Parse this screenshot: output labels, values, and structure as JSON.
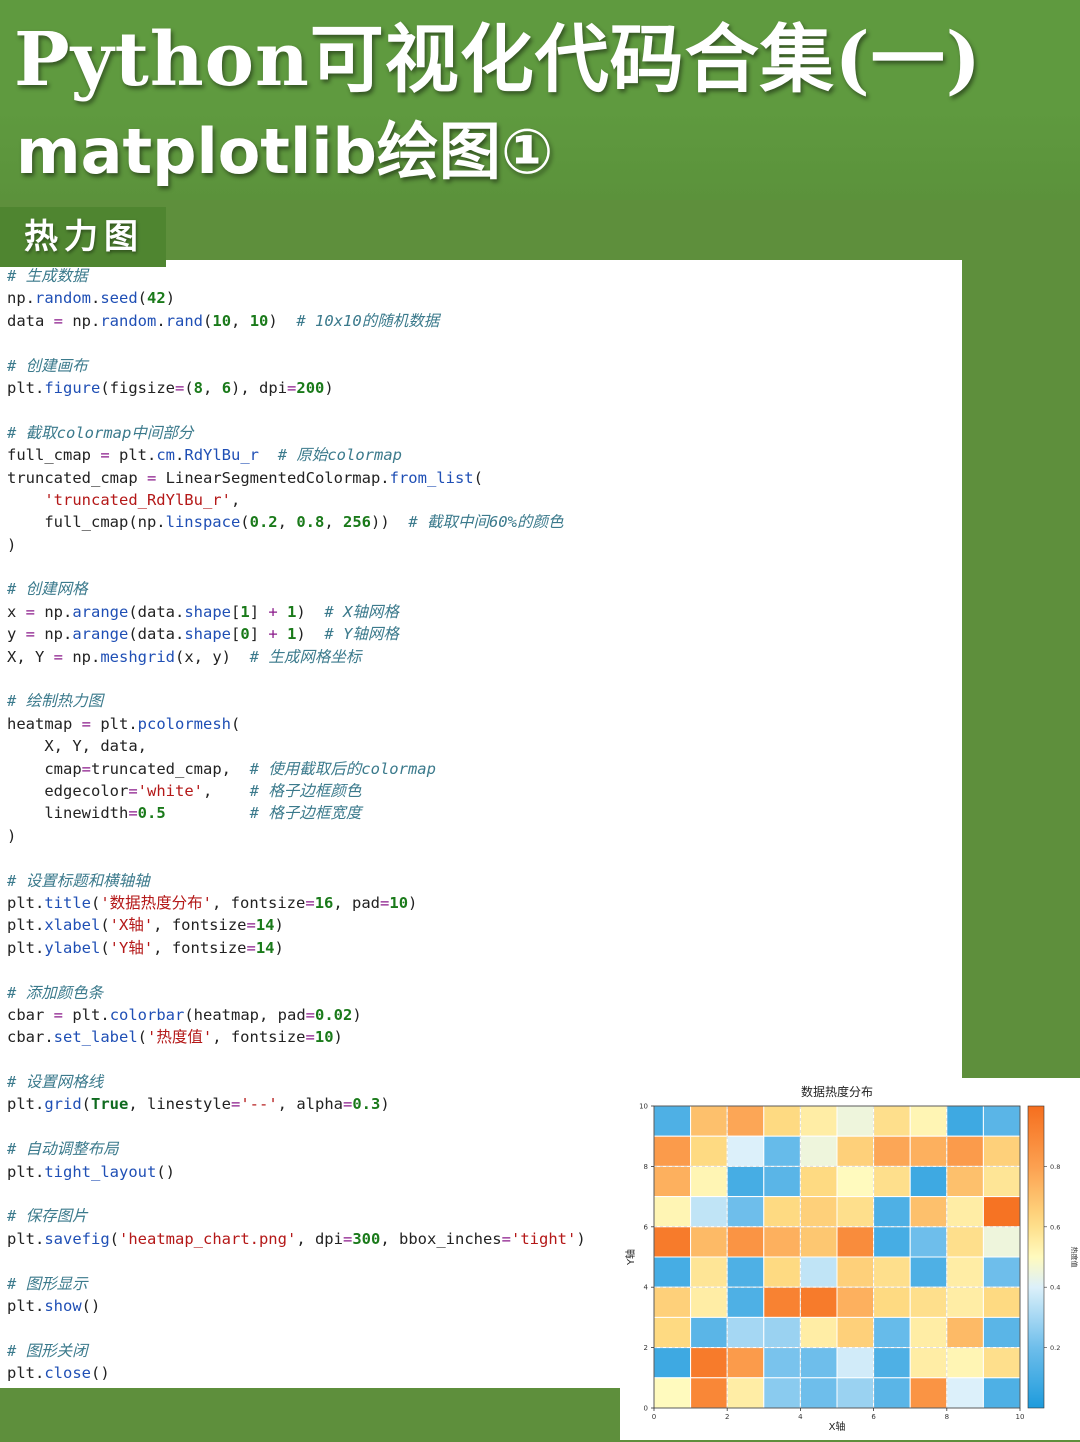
{
  "header": {
    "title_line1": "Python可视化代码合集(一)",
    "title_line2": "matplotlib绘图①",
    "section_label": "热力图"
  },
  "code_lines": [
    "# 生成数据",
    "np.random.seed(42)",
    "data = np.random.rand(10, 10)  # 10x10的随机数据",
    "",
    "# 创建画布",
    "plt.figure(figsize=(8, 6), dpi=200)",
    "",
    "# 截取colormap中间部分",
    "full_cmap = plt.cm.RdYlBu_r  # 原始colormap",
    "truncated_cmap = LinearSegmentedColormap.from_list(",
    "    'truncated_RdYlBu_r',",
    "    full_cmap(np.linspace(0.2, 0.8, 256))  # 截取中间60%的颜色",
    ")",
    "",
    "# 创建网格",
    "x = np.arange(data.shape[1] + 1)  # X轴网格",
    "y = np.arange(data.shape[0] + 1)  # Y轴网格",
    "X, Y = np.meshgrid(x, y)  # 生成网格坐标",
    "",
    "# 绘制热力图",
    "heatmap = plt.pcolormesh(",
    "    X, Y, data,",
    "    cmap=truncated_cmap,  # 使用截取后的colormap",
    "    edgecolor='white',    # 格子边框颜色",
    "    linewidth=0.5         # 格子边框宽度",
    ")",
    "",
    "# 设置标题和横轴轴",
    "plt.title('数据热度分布', fontsize=16, pad=10)",
    "plt.xlabel('X轴', fontsize=14)",
    "plt.ylabel('Y轴', fontsize=14)",
    "",
    "# 添加颜色条",
    "cbar = plt.colorbar(heatmap, pad=0.02)",
    "cbar.set_label('热度值', fontsize=10)",
    "",
    "# 设置网格线",
    "plt.grid(True, linestyle='--', alpha=0.3)",
    "",
    "# 自动调整布局",
    "plt.tight_layout()",
    "",
    "# 保存图片",
    "plt.savefig('heatmap_chart.png', dpi=300, bbox_inches='tight')",
    "",
    "# 图形显示",
    "plt.show()",
    "",
    "# 图形关闭",
    "plt.close()"
  ],
  "colors": {
    "background_green": "#5e8f3c",
    "comment": "#3b7a8c",
    "function": "#1f4fb5",
    "number": "#1a7a1a",
    "string": "#b41818"
  },
  "chart_data": {
    "type": "heatmap",
    "title": "数据热度分布",
    "xlabel": "X轴",
    "ylabel": "Y轴",
    "colorbar_label": "热度值",
    "xlim": [
      0,
      10
    ],
    "ylim": [
      0,
      10
    ],
    "x_ticks": [
      "0",
      "2",
      "4",
      "6",
      "8",
      "10"
    ],
    "y_ticks": [
      "0",
      "2",
      "4",
      "6",
      "8",
      "10"
    ],
    "colorbar_ticks": [
      "0.2",
      "0.4",
      "0.6",
      "0.8"
    ],
    "colorbar_range": [
      0.0,
      1.0
    ],
    "grid": true,
    "colormap": "truncated RdYlBu_r (0.2-0.8)",
    "values_top_row_first": [
      [
        0.12,
        0.7,
        0.78,
        0.62,
        0.55,
        0.45,
        0.6,
        0.52,
        0.08,
        0.15
      ],
      [
        0.82,
        0.62,
        0.4,
        0.18,
        0.45,
        0.65,
        0.78,
        0.75,
        0.82,
        0.65
      ],
      [
        0.75,
        0.52,
        0.1,
        0.15,
        0.62,
        0.5,
        0.6,
        0.08,
        0.7,
        0.58
      ],
      [
        0.52,
        0.35,
        0.2,
        0.62,
        0.65,
        0.6,
        0.12,
        0.7,
        0.55,
        0.98
      ],
      [
        0.95,
        0.72,
        0.85,
        0.75,
        0.68,
        0.88,
        0.1,
        0.2,
        0.6,
        0.45
      ],
      [
        0.1,
        0.58,
        0.12,
        0.62,
        0.35,
        0.65,
        0.6,
        0.12,
        0.55,
        0.2
      ],
      [
        0.65,
        0.55,
        0.12,
        0.92,
        0.95,
        0.75,
        0.62,
        0.6,
        0.55,
        0.62
      ],
      [
        0.62,
        0.15,
        0.3,
        0.28,
        0.55,
        0.65,
        0.18,
        0.55,
        0.72,
        0.15
      ],
      [
        0.08,
        0.95,
        0.82,
        0.22,
        0.2,
        0.38,
        0.12,
        0.55,
        0.52,
        0.6
      ],
      [
        0.5,
        0.9,
        0.55,
        0.25,
        0.2,
        0.28,
        0.15,
        0.85,
        0.4,
        0.12
      ]
    ]
  }
}
